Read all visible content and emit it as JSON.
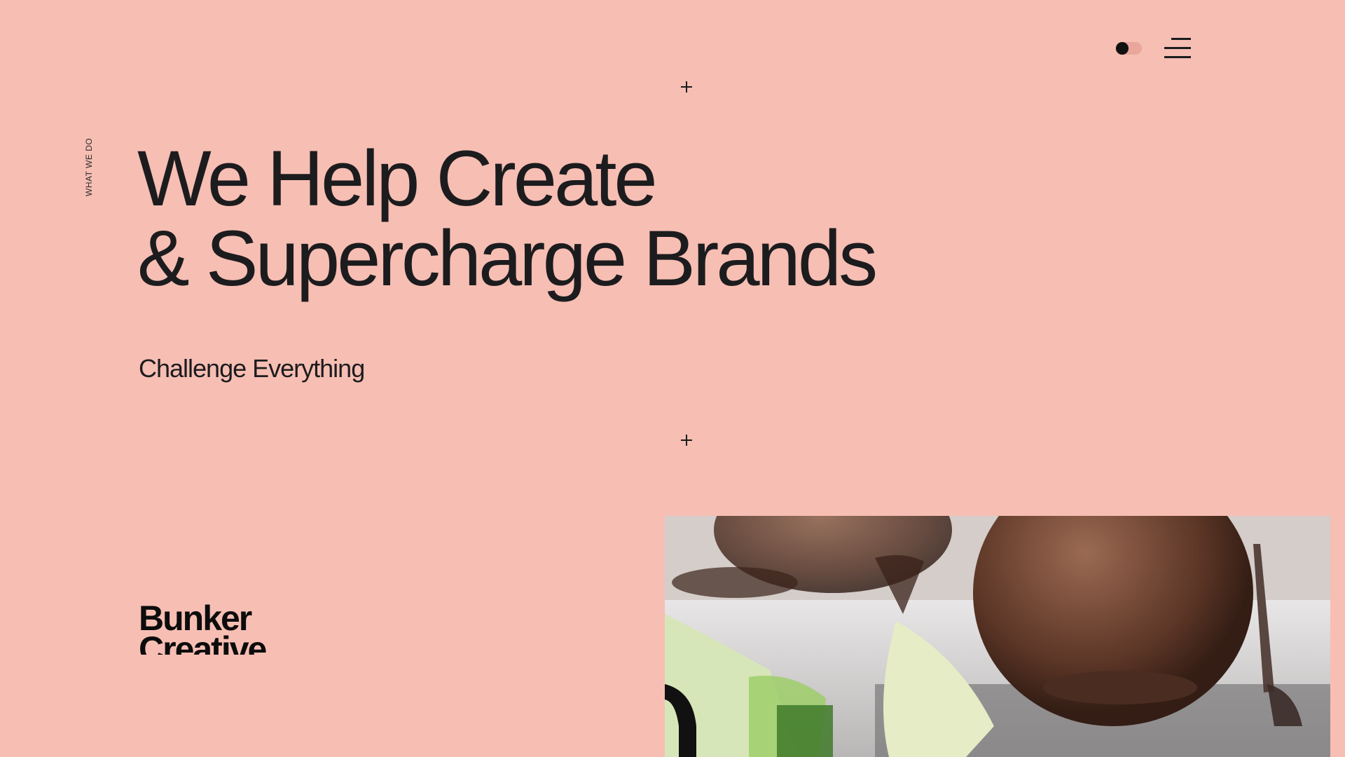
{
  "header": {
    "toggle_icon": "theme-toggle-icon",
    "menu_icon": "hamburger-menu-icon"
  },
  "section": {
    "side_label": "WHAT WE DO",
    "headline_line1": "We Help Create",
    "headline_line2": "& Supercharge Brands",
    "subhead": "Challenge Everything"
  },
  "logo": {
    "line1": "Bunker",
    "line2": "Creative"
  },
  "colors": {
    "background": "#f7beb3",
    "text": "#1c1c1e"
  }
}
